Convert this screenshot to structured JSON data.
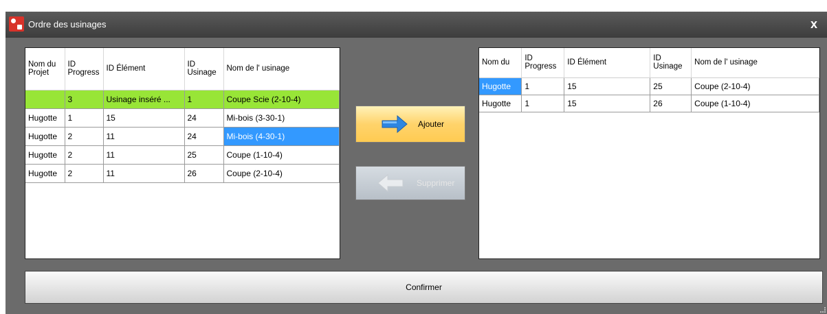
{
  "window": {
    "title": "Ordre des usinages",
    "close_label": "x"
  },
  "left_table": {
    "columns": [
      "Nom du Projet",
      "ID Progress",
      "ID Élément",
      "ID Usinage",
      "Nom de l' usinage"
    ],
    "rows": [
      [
        "",
        "3",
        "Usinage inséré ...",
        "1",
        "Coupe Scie (2-10-4)"
      ],
      [
        "Hugotte",
        "1",
        "15",
        "24",
        "Mi-bois (3-30-1)"
      ],
      [
        "Hugotte",
        "2",
        "11",
        "24",
        "Mi-bois (4-30-1)"
      ],
      [
        "Hugotte",
        "2",
        "11",
        "25",
        "Coupe (1-10-4)"
      ],
      [
        "Hugotte",
        "2",
        "11",
        "26",
        "Coupe (2-10-4)"
      ]
    ],
    "highlight_row_color": "#98e537",
    "selected_color": "#3399ff"
  },
  "right_table": {
    "columns": [
      "Nom du",
      "ID Progress",
      "ID Élément",
      "ID Usinage",
      "Nom de l' usinage"
    ],
    "rows": [
      [
        "Hugotte",
        "1",
        "15",
        "25",
        "Coupe (2-10-4)"
      ],
      [
        "Hugotte",
        "1",
        "15",
        "26",
        "Coupe (1-10-4)"
      ]
    ]
  },
  "buttons": {
    "add": "Ajouter",
    "remove": "Supprimer",
    "confirm": "Confirmer"
  },
  "icons": {
    "app": "app-icon",
    "add": "arrow-right-icon",
    "remove": "arrow-left-icon"
  }
}
